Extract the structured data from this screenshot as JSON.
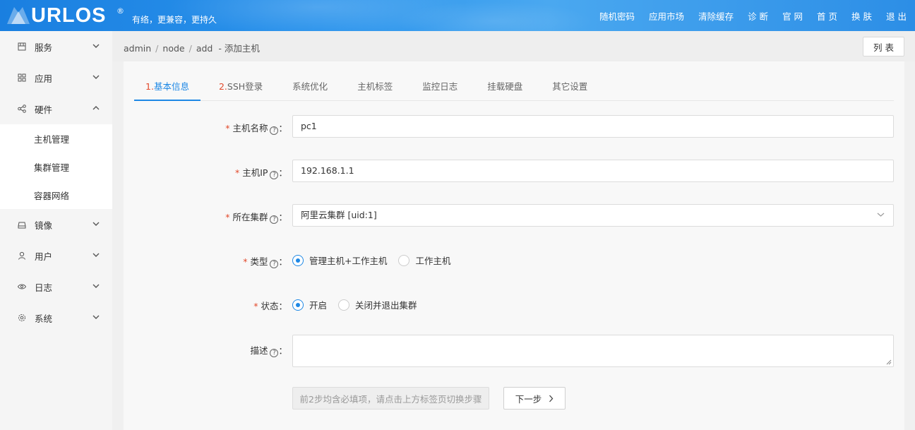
{
  "header": {
    "logo_text": "URLOS",
    "logo_reg": "®",
    "slogan": "有络，更兼容，更持久",
    "nav": [
      "随机密码",
      "应用市场",
      "清除缓存",
      "诊 断",
      "官 网",
      "首 页",
      "换 肤",
      "退 出"
    ]
  },
  "sidebar": {
    "items": [
      {
        "label": "服务",
        "icon": "grid-icon",
        "expanded": false
      },
      {
        "label": "应用",
        "icon": "apps-icon",
        "expanded": false
      },
      {
        "label": "硬件",
        "icon": "share-icon",
        "expanded": true
      },
      {
        "label": "镜像",
        "icon": "disk-icon",
        "expanded": false
      },
      {
        "label": "用户",
        "icon": "user-icon",
        "expanded": false
      },
      {
        "label": "日志",
        "icon": "eye-icon",
        "expanded": false
      },
      {
        "label": "系统",
        "icon": "gear-icon",
        "expanded": false
      }
    ],
    "sub_items": [
      "主机管理",
      "集群管理",
      "容器网络"
    ]
  },
  "breadcrumb": {
    "parts": [
      "admin",
      "node",
      "add"
    ],
    "dash": "-",
    "page": "添加主机"
  },
  "list_button": "列 表",
  "tabs": [
    {
      "num": "1.",
      "label": "基本信息",
      "active": true
    },
    {
      "num": "2.",
      "label": "SSH登录",
      "active": false
    },
    {
      "num": "",
      "label": "系统优化",
      "active": false
    },
    {
      "num": "",
      "label": "主机标签",
      "active": false
    },
    {
      "num": "",
      "label": "监控日志",
      "active": false
    },
    {
      "num": "",
      "label": "挂载硬盘",
      "active": false
    },
    {
      "num": "",
      "label": "其它设置",
      "active": false
    }
  ],
  "form": {
    "required_mark": "*",
    "help_mark": "?",
    "host_name": {
      "label": "主机名称",
      "value": "pc1"
    },
    "host_ip": {
      "label": "主机IP",
      "value": "192.168.1.1"
    },
    "cluster": {
      "label": "所在集群",
      "value": "阿里云集群 [uid:1]"
    },
    "type": {
      "label": "类型",
      "options": [
        "管理主机+工作主机",
        "工作主机"
      ],
      "selected": 0
    },
    "status": {
      "label": "状态",
      "options": [
        "开启",
        "关闭并退出集群"
      ],
      "selected": 0
    },
    "description": {
      "label": "描述",
      "value": ""
    },
    "colon": "："
  },
  "buttons": {
    "hint": "前2步均含必填项，请点击上方标签页切换步骤",
    "next": "下一步"
  },
  "colors": {
    "accent": "#1e88e5",
    "required": "#e2492b",
    "header_bg": "#2a93ec"
  }
}
